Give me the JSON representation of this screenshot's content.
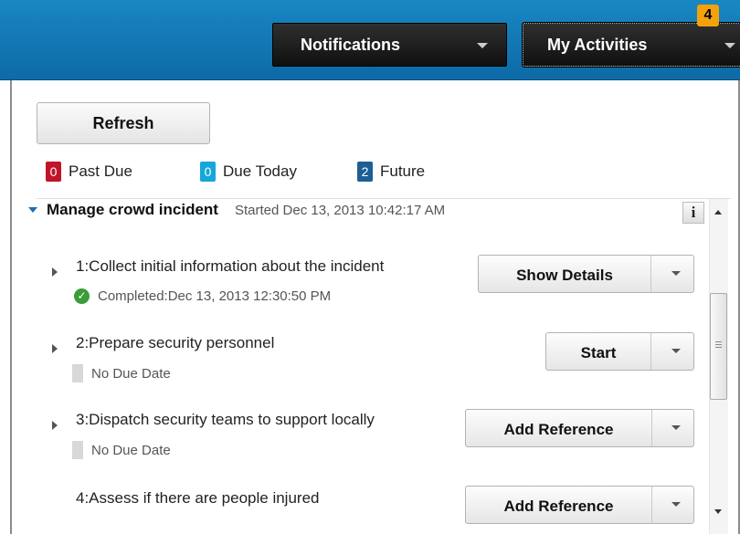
{
  "header": {
    "notifications_label": "Notifications",
    "activities_label": "My Activities",
    "activities_count": "4"
  },
  "toolbar": {
    "refresh_label": "Refresh"
  },
  "legend": [
    {
      "count": "0",
      "label": "Past Due",
      "color": "#c0142a"
    },
    {
      "count": "0",
      "label": "Due Today",
      "color": "#16a6d9"
    },
    {
      "count": "2",
      "label": "Future",
      "color": "#1d5f95"
    }
  ],
  "process": {
    "title": "Manage crowd incident",
    "started": "Started Dec 13, 2013 10:42:17 AM",
    "info_label": "i"
  },
  "tasks": [
    {
      "title": "1:Collect initial information about the incident",
      "status": "Completed:Dec 13, 2013 12:30:50 PM",
      "action": "Show Details"
    },
    {
      "title": "2:Prepare security personnel",
      "status": "No Due Date",
      "action": "Start"
    },
    {
      "title": "3:Dispatch security teams to support locally",
      "status": "No Due Date",
      "action": "Add Reference"
    },
    {
      "title": "4:Assess if there are people injured",
      "status": "",
      "action": "Add Reference"
    }
  ],
  "icons": {
    "check": "✓"
  }
}
